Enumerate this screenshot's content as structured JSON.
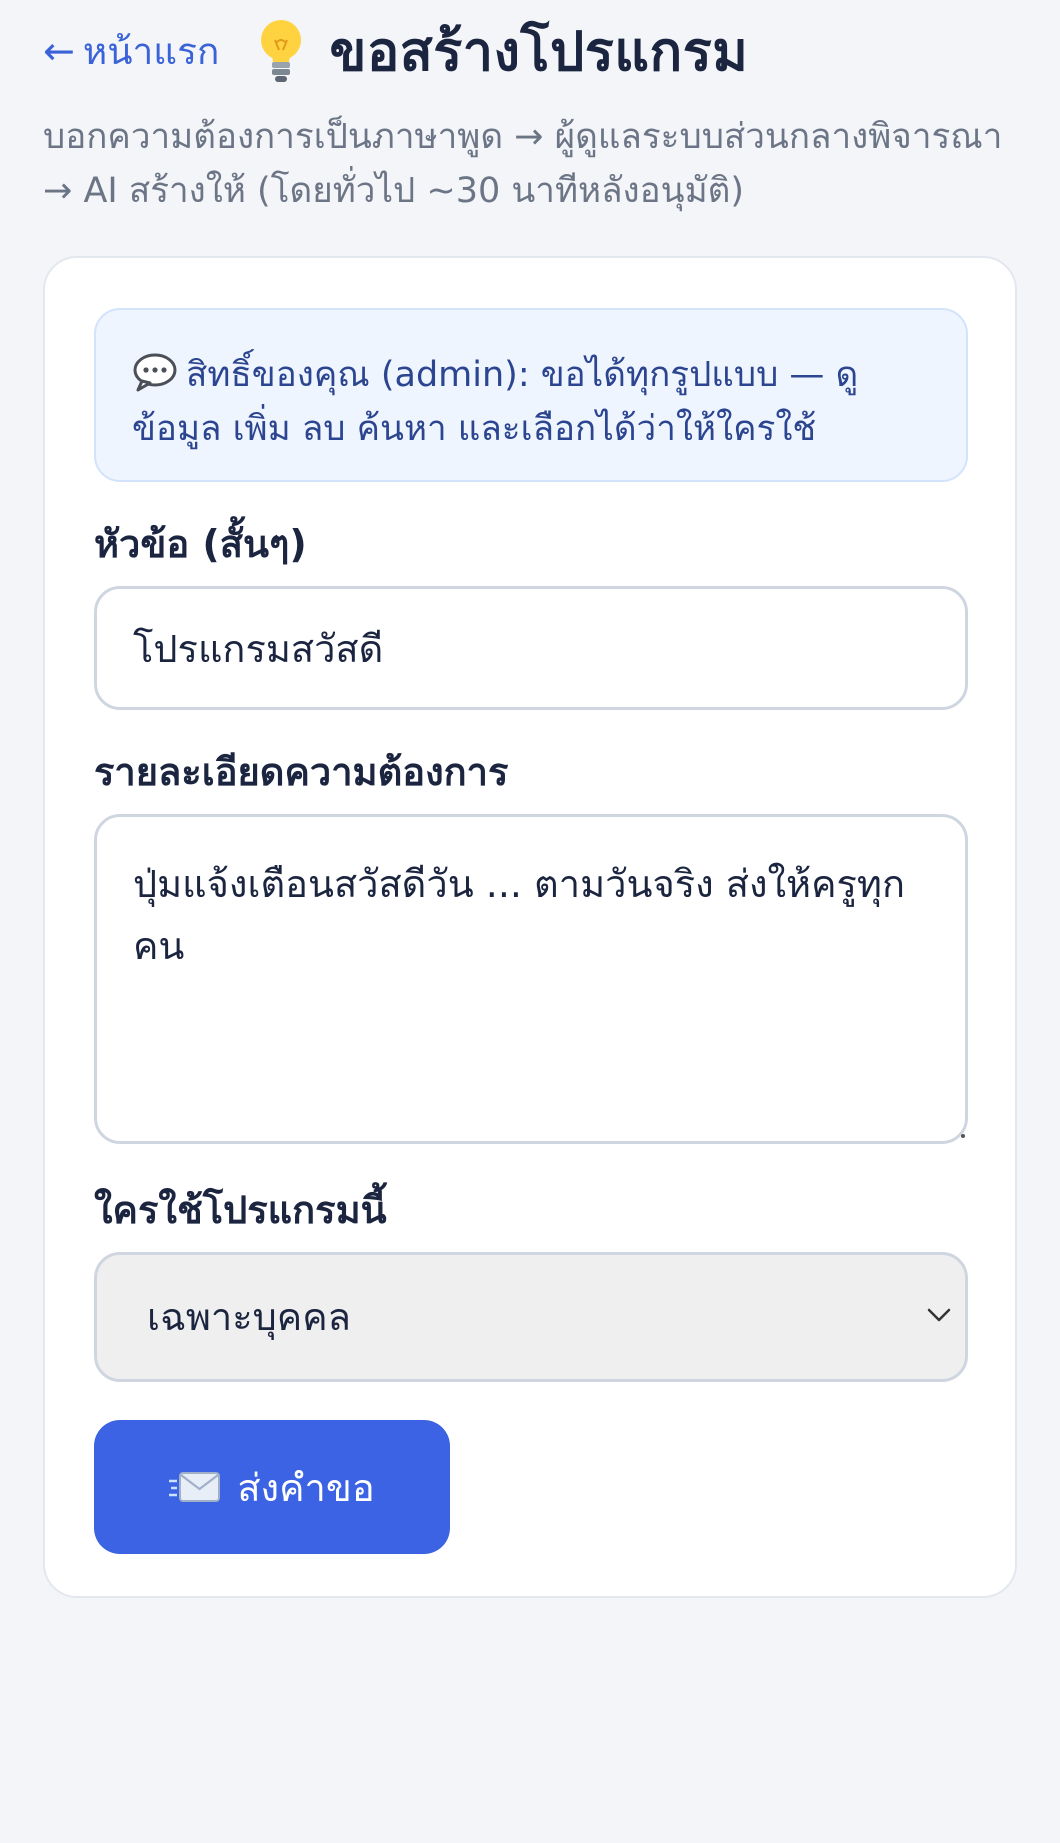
{
  "header": {
    "back_label": "หน้าแรก",
    "back_arrow": "←",
    "title": "ขอสร้างโปรแกรม",
    "title_icon": "lightbulb-icon"
  },
  "subtitle": "บอกความต้องการเป็นภาษาพูด → ผู้ดูแลระบบส่วนกลางพิจารณา → AI สร้างให้ (โดยทั่วไป ~30 นาทีหลังอนุมัติ)",
  "notice": {
    "icon": "speech-bubble-icon",
    "text": "สิทธิ์ของคุณ (admin): ขอได้ทุกรูปแบบ — ดูข้อมูล เพิ่ม ลบ ค้นหา และเลือกได้ว่าให้ใครใช้"
  },
  "form": {
    "title_label": "หัวข้อ (สั้นๆ)",
    "title_value": "โปรแกรมสวัสดี",
    "details_label": "รายละเอียดความต้องการ",
    "details_value": "ปุ่มแจ้งเตือนสวัสดีวัน ... ตามวันจริง ส่งให้ครูทุกคน",
    "audience_label": "ใครใช้โปรแกรมนี้",
    "audience_selected": "เฉพาะบุคคล",
    "submit_label": "ส่งคำขอ",
    "submit_icon": "envelope-icon"
  },
  "colors": {
    "accent": "#3b63e4",
    "link": "#3a63d8",
    "notice_bg": "#eef5ff"
  }
}
